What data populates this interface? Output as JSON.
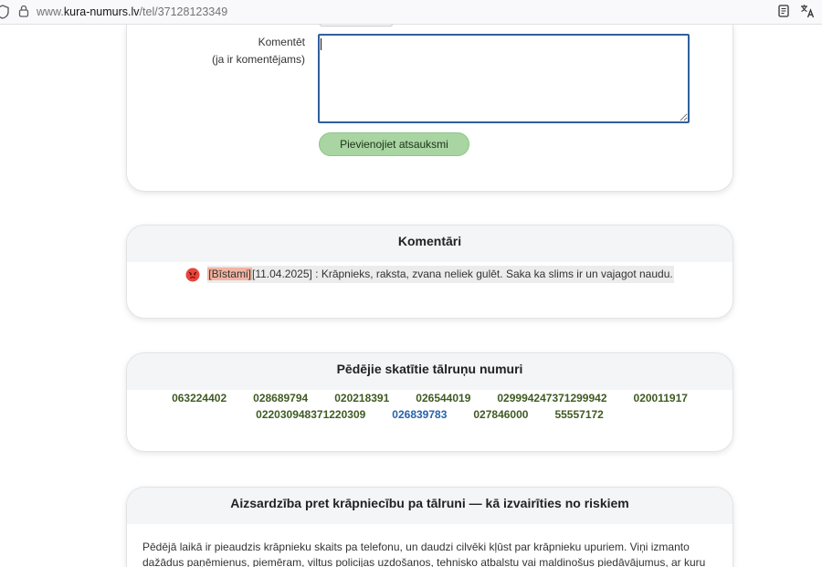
{
  "browser": {
    "url_prefix": "www.",
    "url_domain": "kura-numurs.lv",
    "url_path": "/tel/37128123349",
    "icons": [
      "shield-icon",
      "lock-icon",
      "reader-view-icon",
      "translate-icon"
    ]
  },
  "comment_form": {
    "label_line1": "Komentēt",
    "label_line2": "(ja ir komentējams)",
    "submit_label": "Pievienojiet atsauksmi"
  },
  "comments": {
    "title": "Komentāri",
    "items": [
      {
        "icon": "angry-face-icon",
        "tag": "[Bīstami]",
        "date": "[11.04.2025]",
        "text": " : Krāpnieks, raksta, zvana neliek gulēt. Saka ka slims ir un vajagot naudu."
      }
    ]
  },
  "recent_numbers": {
    "title": "Pēdējie skatītie tālruņu numuri",
    "items": [
      {
        "value": "063224402",
        "color": "#3f5b22"
      },
      {
        "value": "028689794",
        "color": "#3f5b22"
      },
      {
        "value": "020218391",
        "color": "#3f5b22"
      },
      {
        "value": "026544019",
        "color": "#3f5b22"
      },
      {
        "value": "029994247371299942",
        "color": "#3f5b22"
      },
      {
        "value": "020011917",
        "color": "#3f5b22"
      },
      {
        "value": "022030948371220309",
        "color": "#3f5b22"
      },
      {
        "value": "026839783",
        "color": "#2563a8"
      },
      {
        "value": "027846000",
        "color": "#3f5b22"
      },
      {
        "value": "55557172",
        "color": "#3f5b22"
      }
    ]
  },
  "article": {
    "title": "Aizsardzība pret krāpniecību pa tālruni — kā izvairīties no riskiem",
    "paragraph": "Pēdējā laikā ir pieaudzis krāpnieku skaits pa telefonu, un daudzi cilvēki kļūst par krāpnieku upuriem. Viņi izmanto dažādus paņēmienus, piemēram, viltus policijas uzdošanos, tehnisko atbalstu vai maldinošus piedāvājumus, ar kuru"
  },
  "colors": {
    "textarea_focus_border": "#2f5f9c",
    "button_background": "#a8d5a1",
    "danger_tag_background": "#f3b4a2",
    "comment_background": "#ececec",
    "card_header_background": "#f3f5f7"
  }
}
